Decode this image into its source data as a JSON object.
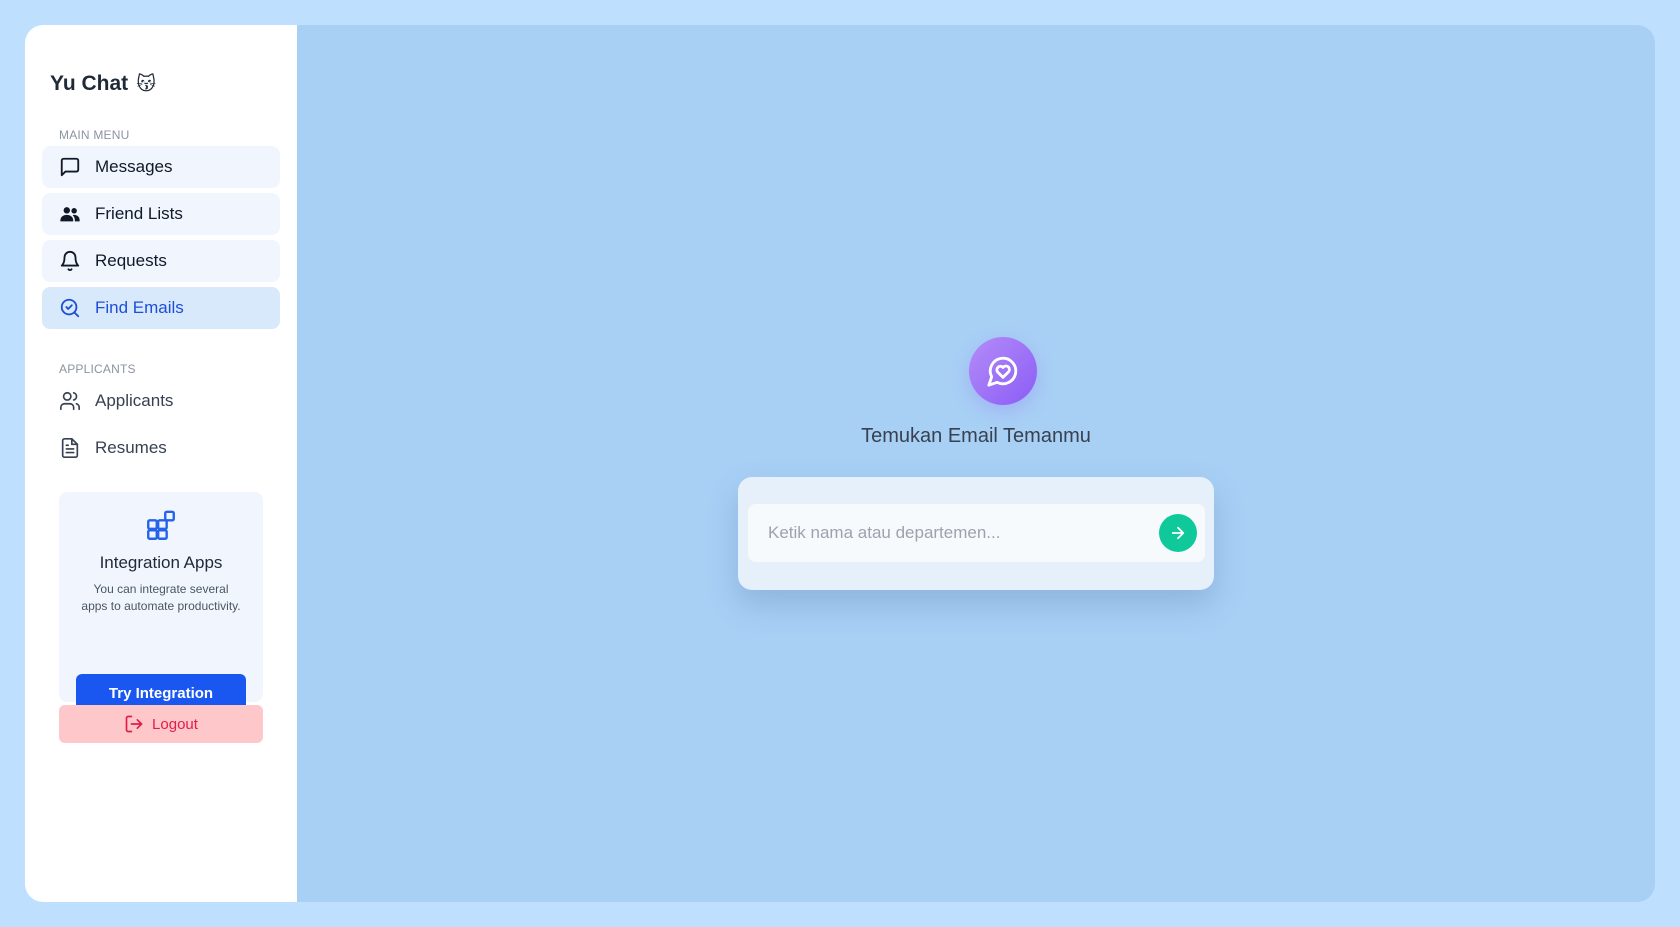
{
  "sidebar": {
    "brand": "Yu Chat",
    "brand_emoji": "😽",
    "main_menu_label": "MAIN MENU",
    "main_items": [
      {
        "label": "Messages",
        "icon": "message-square-icon"
      },
      {
        "label": "Friend Lists",
        "icon": "users-icon"
      },
      {
        "label": "Requests",
        "icon": "bell-icon"
      },
      {
        "label": "Find Emails",
        "icon": "search-check-icon",
        "active": true
      }
    ],
    "applicants_label": "APPLICANTS",
    "applicant_items": [
      {
        "label": "Applicants",
        "icon": "users-outline-icon"
      },
      {
        "label": "Resumes",
        "icon": "document-icon"
      }
    ],
    "promo": {
      "title": "Integration Apps",
      "description": "You can integrate several apps to automate productivity.",
      "button": "Try Integration"
    },
    "logout": "Logout"
  },
  "main": {
    "title": "Temukan Email Temanmu",
    "search_placeholder": "Ketik nama atau departemen...",
    "search_value": ""
  },
  "colors": {
    "accent": "#1a56f0",
    "active_text": "#1d4ed8",
    "go_button": "#10c99a",
    "logout_bg": "#fec7c9",
    "logout_text": "#e11d48",
    "hero_gradient": "#8b5cf6"
  }
}
